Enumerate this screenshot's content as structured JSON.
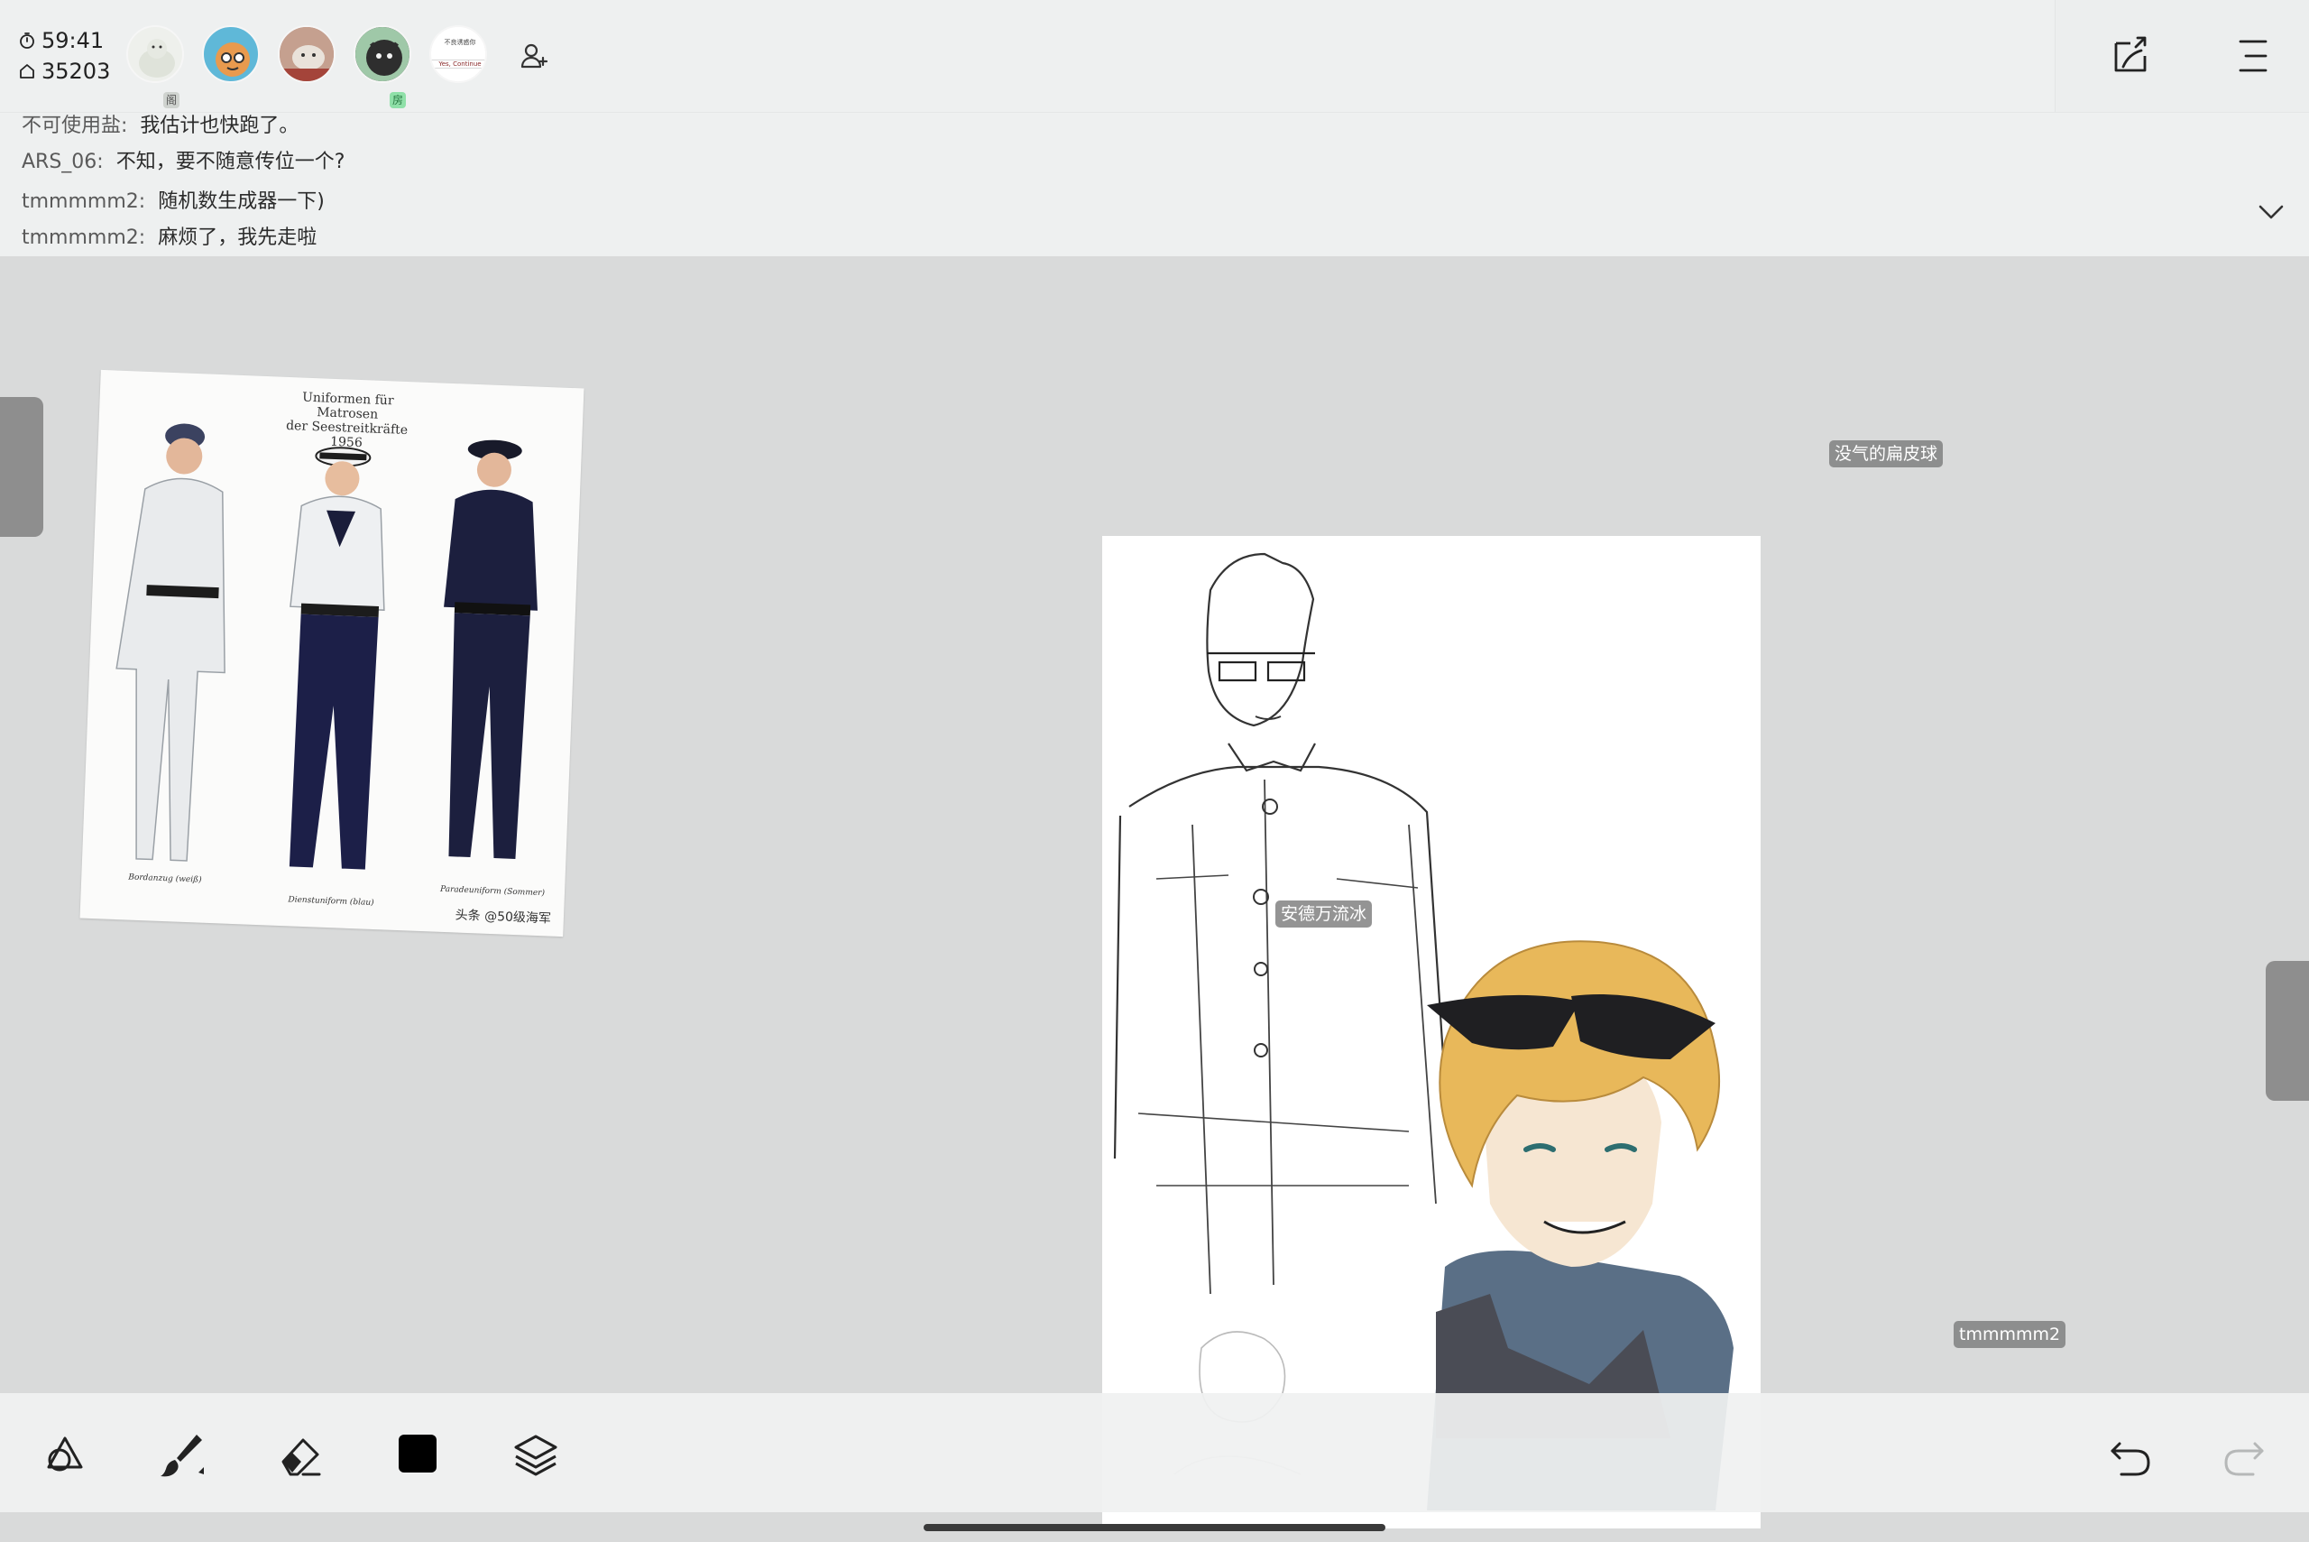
{
  "status": {
    "timer": "59:41",
    "score": "35203"
  },
  "participants": [
    {
      "name": "avatar-1",
      "bg": "#e9ece8",
      "badge": "阁"
    },
    {
      "name": "avatar-2",
      "bg": "#5fb8d8",
      "badge": ""
    },
    {
      "name": "avatar-3",
      "bg": "#b78a7a",
      "badge": ""
    },
    {
      "name": "avatar-4",
      "bg": "#3f4a3f",
      "badge": "房"
    },
    {
      "name": "avatar-5",
      "bg": "#ffffff",
      "badge": ""
    }
  ],
  "avatar5_text": {
    "line1": "不良诱惑你",
    "line2": "Yes, Continue"
  },
  "chat": {
    "messages": [
      {
        "user": "不可使用盐:",
        "text": "我估计也快跑了。"
      },
      {
        "user": "ARS_06:",
        "text": "不知，要不随意传位一个?"
      },
      {
        "user": "tmmmmm2:",
        "text": "随机数生成器一下)"
      },
      {
        "user": "tmmmmm2:",
        "text": "麻烦了，我先走啦"
      }
    ]
  },
  "reference": {
    "caption_line1": "Uniformen für Matrosen",
    "caption_line2": "der Seestreitkräfte 1956",
    "label_left": "Bordanzug (weiß)",
    "label_mid": "Dienstuniform (blau)",
    "label_right": "Paradeuniform (Sommer)",
    "watermark": "头条 @50级海军"
  },
  "cursors": [
    {
      "name": "没气的扁皮球"
    },
    {
      "name": "安德万流冰"
    },
    {
      "name": "tmmmmm2"
    }
  ],
  "colors": {
    "active_color": "#000000",
    "hair": "#e8b85a",
    "collar": "#5a6f86"
  },
  "icons": {
    "timer": "stopwatch-icon",
    "score": "home-icon",
    "add_user": "add-user-icon",
    "share": "share-page-icon",
    "menu": "menu-icon",
    "chat_toggle": "chevron-down-icon",
    "tools": [
      "shapes-icon",
      "brush-icon",
      "eraser-icon",
      "color-swatch",
      "layers-icon",
      "undo-icon",
      "redo-icon"
    ]
  }
}
